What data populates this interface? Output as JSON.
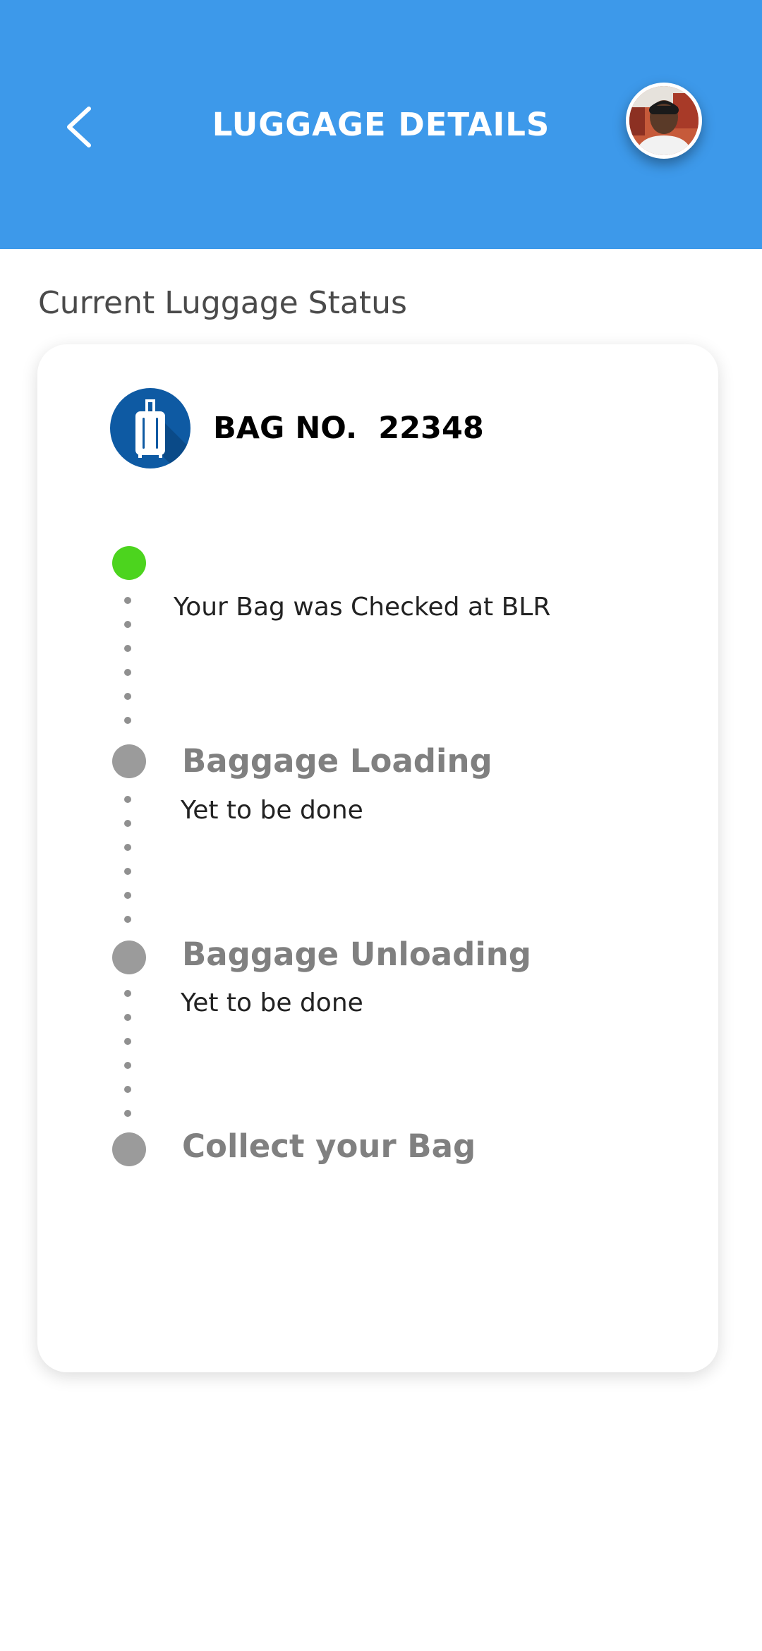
{
  "header": {
    "title": "LUGGAGE DETAILS",
    "background_color": "#3d99ea",
    "back_icon": "chevron-left-icon",
    "avatar": "user-avatar"
  },
  "section": {
    "title": "Current Luggage Status"
  },
  "bag": {
    "label": "BAG NO.  22348",
    "icon": "suitcase-icon"
  },
  "timeline": {
    "completed_color": "#4cd41e",
    "pending_color": "#9b9b9b",
    "steps": [
      {
        "title": "",
        "subtitle": "Your Bag was Checked at BLR",
        "status": "done"
      },
      {
        "title": "Baggage Loading",
        "subtitle": "Yet to be done",
        "status": "pending"
      },
      {
        "title": "Baggage Unloading",
        "subtitle": "Yet to be done",
        "status": "pending"
      },
      {
        "title": "Collect your Bag",
        "subtitle": "",
        "status": "pending"
      }
    ]
  }
}
